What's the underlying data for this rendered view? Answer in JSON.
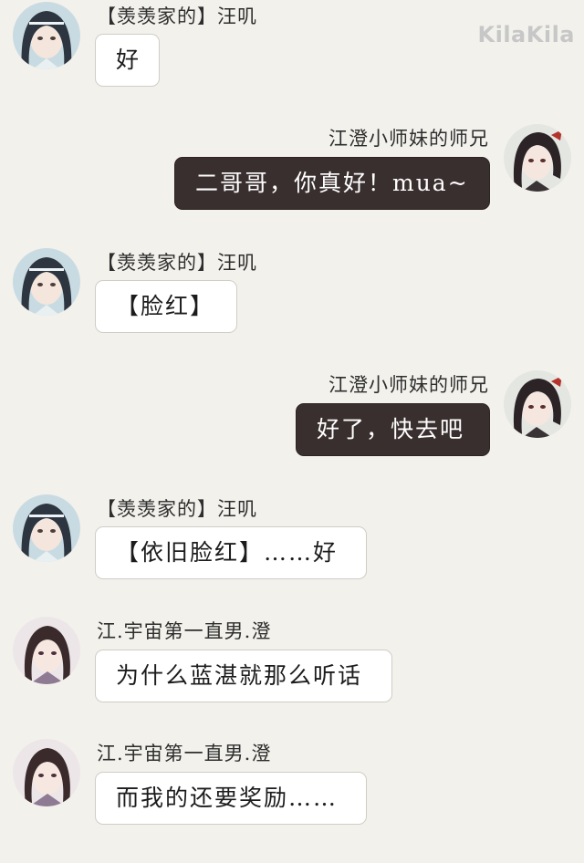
{
  "watermark": "KilaKila",
  "messages": [
    {
      "sender": "【羡羡家的】汪叽",
      "text": "好",
      "side": "left",
      "avatar": "lan-avatar"
    },
    {
      "sender": "江澄小师妹的师兄",
      "text": "二哥哥，你真好！mua~",
      "side": "right",
      "avatar": "wei-avatar"
    },
    {
      "sender": "【羡羡家的】汪叽",
      "text": "【脸红】",
      "side": "left",
      "avatar": "lan-avatar"
    },
    {
      "sender": "江澄小师妹的师兄",
      "text": "好了，快去吧",
      "side": "right",
      "avatar": "wei-avatar"
    },
    {
      "sender": "【羡羡家的】汪叽",
      "text": "【依旧脸红】……好",
      "side": "left",
      "avatar": "lan-avatar"
    },
    {
      "sender": "江.宇宙第一直男.澄",
      "text": "为什么蓝湛就那么听话",
      "side": "left",
      "avatar": "jiang-avatar"
    },
    {
      "sender": "江.宇宙第一直男.澄",
      "text": "而我的还要奖励……",
      "side": "left",
      "avatar": "jiang-avatar"
    }
  ],
  "colors": {
    "background": "#f3f1ec",
    "left_bubble": "#ffffff",
    "right_bubble": "#3a2f2f"
  }
}
